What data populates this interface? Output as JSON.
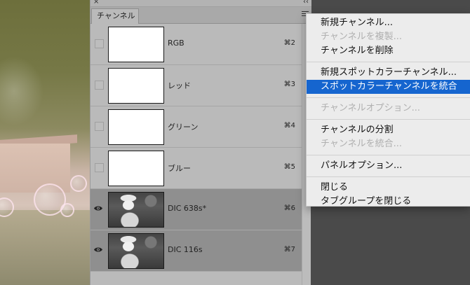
{
  "panel": {
    "tab_label": "チャンネル",
    "close_glyph": "×",
    "collapse_glyph": "‹‹"
  },
  "channels": [
    {
      "name": "RGB",
      "shortcut": "⌘2",
      "visible": false,
      "thumb": "blank"
    },
    {
      "name": "レッド",
      "shortcut": "⌘3",
      "visible": false,
      "thumb": "blank"
    },
    {
      "name": "グリーン",
      "shortcut": "⌘4",
      "visible": false,
      "thumb": "blank"
    },
    {
      "name": "ブルー",
      "shortcut": "⌘5",
      "visible": false,
      "thumb": "blank"
    },
    {
      "name": "DIC 638s*",
      "shortcut": "⌘6",
      "visible": true,
      "thumb": "photo"
    },
    {
      "name": "DIC 116s",
      "shortcut": "⌘7",
      "visible": true,
      "thumb": "photo"
    }
  ],
  "menu": {
    "items": [
      {
        "label": "新規チャンネル...",
        "enabled": true
      },
      {
        "label": "チャンネルを複製...",
        "enabled": false
      },
      {
        "label": "チャンネルを削除",
        "enabled": true
      },
      {
        "label": "新規スポットカラーチャンネル...",
        "enabled": true
      },
      {
        "label": "スポットカラーチャンネルを統合",
        "enabled": true,
        "selected": true
      },
      {
        "label": "チャンネルオプション...",
        "enabled": false
      },
      {
        "label": "チャンネルの分割",
        "enabled": true
      },
      {
        "label": "チャンネルを統合...",
        "enabled": false
      },
      {
        "label": "パネルオプション...",
        "enabled": true
      },
      {
        "label": "閉じる",
        "enabled": true
      },
      {
        "label": "タブグループを閉じる",
        "enabled": true
      }
    ]
  },
  "colors": {
    "highlight": "#1565cf",
    "panel_bg": "#bababa",
    "active_row": "#8f8f8f"
  }
}
